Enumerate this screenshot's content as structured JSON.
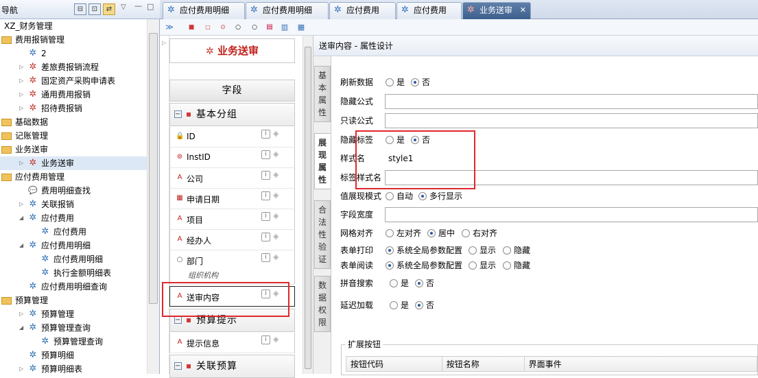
{
  "nav": {
    "title": "导航",
    "buttons": [
      "⊟",
      "⊡",
      "⇄"
    ],
    "chev": "▽",
    "min": "—",
    "max": "□",
    "tree": [
      {
        "label": "XZ_财务管理",
        "indent": 0,
        "icon": "",
        "twisty": ""
      },
      {
        "label": "费用报销管理",
        "indent": 0,
        "icon": "folder",
        "twisty": ""
      },
      {
        "label": "2",
        "indent": 1,
        "icon": "x",
        "twisty": ""
      },
      {
        "label": "差旅费报销流程",
        "indent": 1,
        "icon": "xred",
        "twisty": "▷"
      },
      {
        "label": "固定资产采购申请表",
        "indent": 1,
        "icon": "xred",
        "twisty": "▷"
      },
      {
        "label": "通用费用报销",
        "indent": 1,
        "icon": "xred",
        "twisty": "▷"
      },
      {
        "label": "招待费报销",
        "indent": 1,
        "icon": "xred",
        "twisty": "▷"
      },
      {
        "label": "基础数据",
        "indent": 0,
        "icon": "folder",
        "twisty": ""
      },
      {
        "label": "记账管理",
        "indent": 0,
        "icon": "folder",
        "twisty": ""
      },
      {
        "label": "业务送审",
        "indent": 0,
        "icon": "folder",
        "twisty": ""
      },
      {
        "label": "业务送审",
        "indent": 1,
        "icon": "xred",
        "twisty": "▷"
      },
      {
        "label": "应付费用管理",
        "indent": 0,
        "icon": "folder",
        "twisty": ""
      },
      {
        "label": "费用明细查找",
        "indent": 1,
        "icon": "chat",
        "twisty": ""
      },
      {
        "label": "关联报销",
        "indent": 1,
        "icon": "x",
        "twisty": "▷"
      },
      {
        "label": "应付费用",
        "indent": 1,
        "icon": "x",
        "twisty": "◢"
      },
      {
        "label": "应付费用",
        "indent": 2,
        "icon": "x",
        "twisty": ""
      },
      {
        "label": "应付费用明细",
        "indent": 1,
        "icon": "x",
        "twisty": "◢"
      },
      {
        "label": "应付费用明细",
        "indent": 2,
        "icon": "x",
        "twisty": ""
      },
      {
        "label": "执行金额明细表",
        "indent": 2,
        "icon": "x",
        "twisty": ""
      },
      {
        "label": "应付费用明细查询",
        "indent": 1,
        "icon": "x",
        "twisty": ""
      },
      {
        "label": "预算管理",
        "indent": 0,
        "icon": "folder",
        "twisty": ""
      },
      {
        "label": "预算管理",
        "indent": 1,
        "icon": "x",
        "twisty": "▷"
      },
      {
        "label": "预算管理查询",
        "indent": 1,
        "icon": "x",
        "twisty": "◢"
      },
      {
        "label": "预算管理查询",
        "indent": 2,
        "icon": "x",
        "twisty": ""
      },
      {
        "label": "预算明细",
        "indent": 1,
        "icon": "x",
        "twisty": ""
      },
      {
        "label": "预算明细表",
        "indent": 1,
        "icon": "x",
        "twisty": "▷"
      }
    ]
  },
  "tabs": [
    {
      "label": "应付费用明细"
    },
    {
      "label": "应付费用明细"
    },
    {
      "label": "应付费用"
    },
    {
      "label": "应付费用"
    },
    {
      "label": "业务送审",
      "close": "✕"
    }
  ],
  "form": {
    "title": "业务送审",
    "field_header": "字段",
    "groups": [
      "基本分组",
      "预算提示",
      "关联预算"
    ],
    "fields": [
      {
        "label": "ID",
        "icon": "🔒"
      },
      {
        "label": "InstID",
        "icon": "⊚"
      },
      {
        "label": "公司",
        "icon": "A"
      },
      {
        "label": "申请日期",
        "icon": "▦"
      },
      {
        "label": "项目",
        "icon": "A"
      },
      {
        "label": "经办人",
        "icon": "A"
      },
      {
        "label": "部门",
        "icon": "○",
        "sub": "组织机构"
      },
      {
        "label": "送审内容",
        "icon": "A"
      },
      {
        "label": "提示信息",
        "icon": "A"
      }
    ],
    "info": "i",
    "diamond": "◈"
  },
  "props": {
    "header": "送审内容 - 属性设计",
    "vtabs": [
      "基本属性",
      "展现属性",
      "合法性验证",
      "数据权限"
    ],
    "refresh": {
      "label": "刷新数据",
      "yes": "是",
      "no": "否"
    },
    "hidden_formula": {
      "label": "隐藏公式",
      "value": ""
    },
    "readonly_formula": {
      "label": "只读公式",
      "value": ""
    },
    "hide_label": {
      "label": "隐藏标签",
      "yes": "是",
      "no": "否"
    },
    "style_name": {
      "label": "样式名",
      "value": "style1"
    },
    "label_style": {
      "label": "标签样式名",
      "value": ""
    },
    "value_mode": {
      "label": "值展现模式",
      "opt1": "自动",
      "opt2": "多行显示"
    },
    "field_width": {
      "label": "字段宽度",
      "value": ""
    },
    "grid_align": {
      "label": "网格对齐",
      "opt1": "左对齐",
      "opt2": "居中",
      "opt3": "右对齐"
    },
    "print": {
      "label": "表单打印",
      "opt1": "系统全局参数配置",
      "opt2": "显示",
      "opt3": "隐藏"
    },
    "read": {
      "label": "表单阅读",
      "opt1": "系统全局参数配置",
      "opt2": "显示",
      "opt3": "隐藏"
    },
    "pinyin": {
      "label": "拼音搜索",
      "yes": "是",
      "no": "否"
    },
    "lazy": {
      "label": "延迟加载",
      "yes": "是",
      "no": "否"
    },
    "ext": {
      "legend": "扩展按钮",
      "cols": [
        "按钮代码",
        "按钮名称",
        "界面事件"
      ]
    }
  },
  "colors": {
    "highlight": "#e0262b",
    "accent": "#3d5f8d",
    "brand_red": "#c0201a"
  }
}
